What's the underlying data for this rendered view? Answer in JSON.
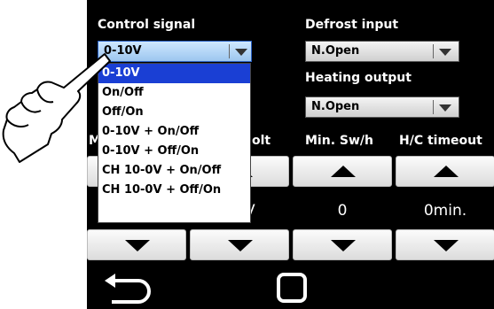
{
  "control_signal": {
    "label": "Control signal",
    "value": "0-10V"
  },
  "defrost_input": {
    "label": "Defrost input",
    "value": "N.Open"
  },
  "heating_output": {
    "label": "Heating output",
    "value": "N.Open"
  },
  "dropdown": {
    "options": [
      "0-10V",
      "On/Off",
      "Off/On",
      "0-10V + On/Off",
      "0-10V + Off/On",
      "CH 10-0V + On/Off",
      "CH 10-0V + Off/On"
    ],
    "selected_index": 0
  },
  "columns": {
    "col1_label": "M",
    "col2_label": "olt",
    "col3_label": "Min. Sw/h",
    "col4_label": "H/C timeout"
  },
  "values": {
    "col2_value": "V",
    "col3_value": "0",
    "col4_value": "0min."
  },
  "icons": {
    "back": "back-arrow-icon",
    "home": "square-home-icon",
    "up": "triangle-up-icon",
    "down": "triangle-down-icon",
    "hand": "pointing-hand-icon"
  },
  "colors": {
    "background": "#000000",
    "selected_option": "#1a3fd4"
  }
}
